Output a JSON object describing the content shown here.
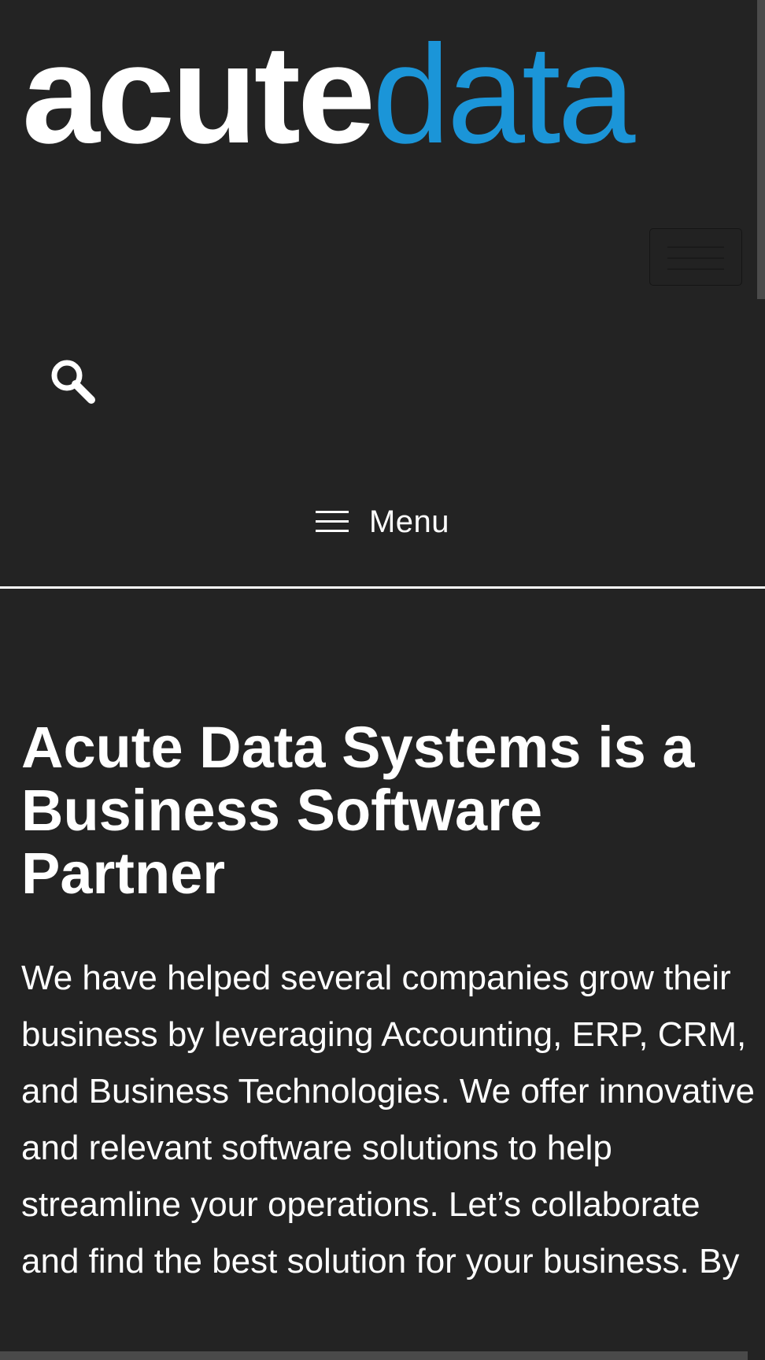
{
  "logo": {
    "part1": "acute",
    "part2": "data"
  },
  "header": {
    "menu_label": "Menu"
  },
  "main": {
    "heading": "Acute Data Systems is a Business Software Partner",
    "paragraph": "We have helped several companies grow their business by leveraging Accounting, ERP, CRM, and Business Technologies. We offer innovative and relevant software solutions to help streamline your operations. Let’s collaborate and find the best solution for your business. By"
  },
  "colors": {
    "background": "#232323",
    "brand_blue": "#1b95d8",
    "text": "#ffffff"
  },
  "icons": [
    "search-icon",
    "hamburger-icon",
    "menu-icon"
  ]
}
